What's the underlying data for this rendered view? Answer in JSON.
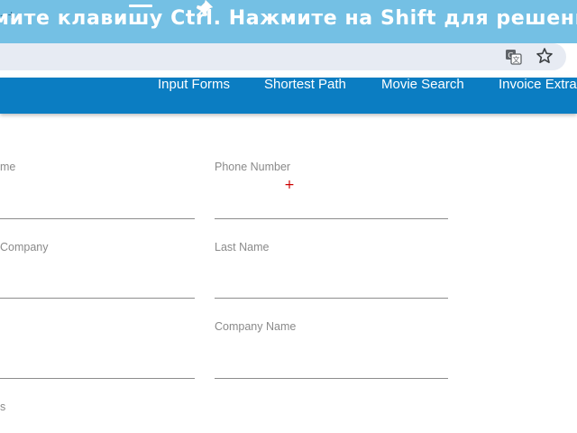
{
  "overlay": {
    "instruction_text": "мите клавишу Ctrl. Нажмите на Shift для решения пр",
    "tab_marker": "- +"
  },
  "toolbar": {
    "translate_icon": "translate-icon",
    "bookmark_icon": "star-icon"
  },
  "nav": {
    "items": [
      {
        "label": "Input Forms"
      },
      {
        "label": "Shortest Path"
      },
      {
        "label": "Movie Search"
      },
      {
        "label": "Invoice Extra"
      }
    ]
  },
  "form": {
    "fields": [
      {
        "label": "me",
        "value": ""
      },
      {
        "label": "Phone Number",
        "value": ""
      },
      {
        "label": "Company",
        "value": ""
      },
      {
        "label": "Last Name",
        "value": ""
      },
      {
        "label": "",
        "value": ""
      },
      {
        "label": "Company Name",
        "value": ""
      },
      {
        "label": "s",
        "value": ""
      }
    ]
  },
  "colors": {
    "nav_bg": "#0b7dc2",
    "tab_strip_bg": "#74c0e4",
    "omnibox_bg": "#e7ebf3",
    "label": "#8a8a8a",
    "marker": "#cc0000"
  }
}
